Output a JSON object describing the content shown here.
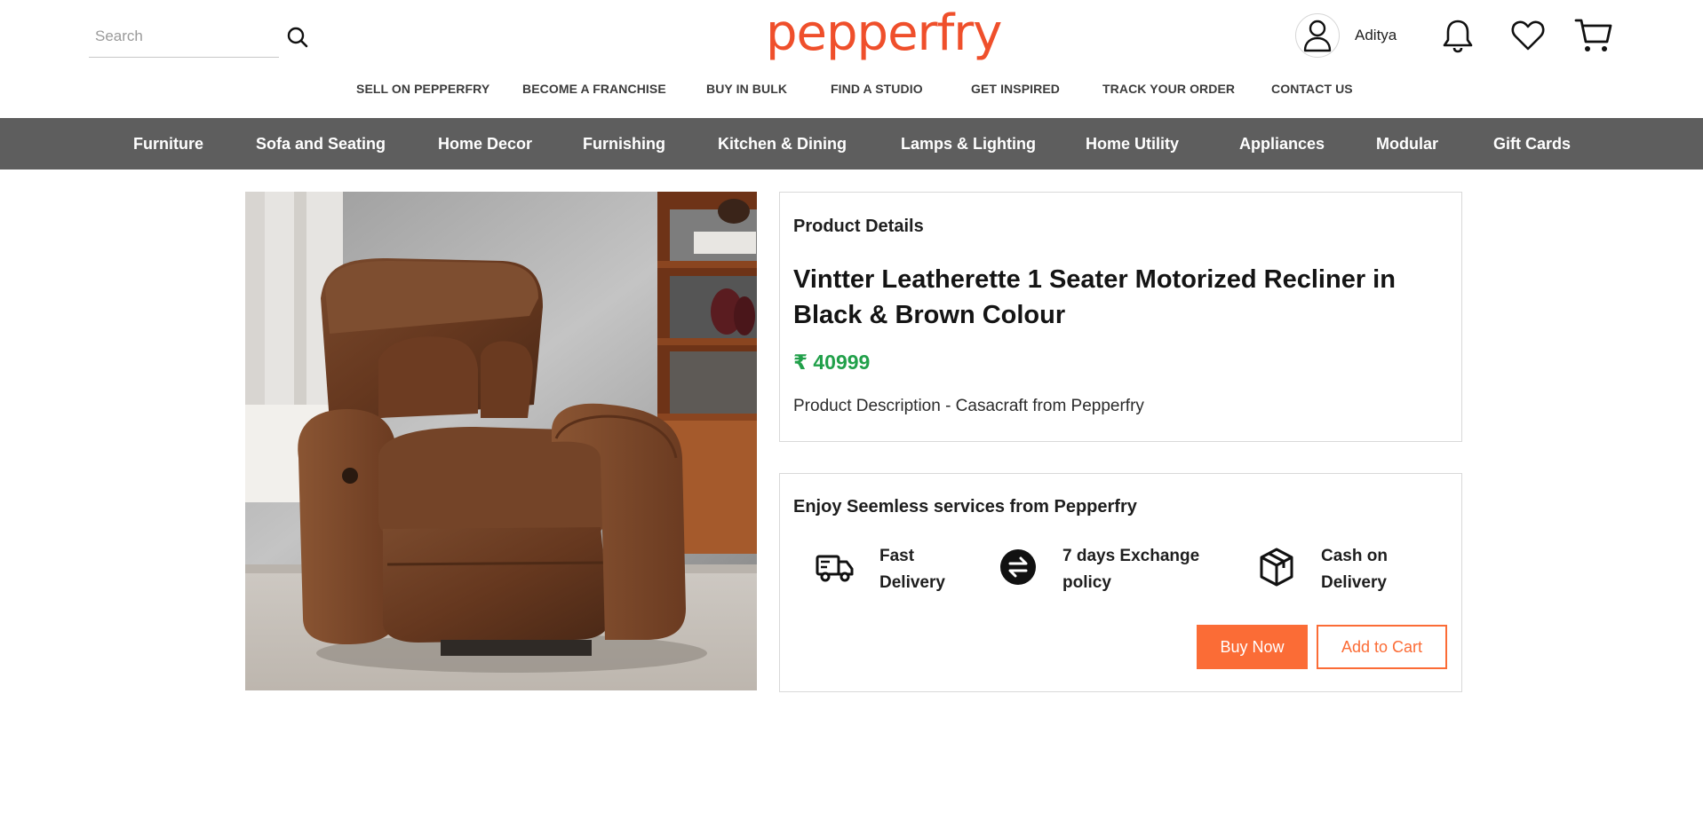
{
  "header": {
    "search_placeholder": "Search",
    "logo_text": "pepperfry",
    "user_name": "Aditya"
  },
  "top_links": [
    {
      "label": "SELL ON PEPPERFRY"
    },
    {
      "label": "BECOME A FRANCHISE"
    },
    {
      "label": "BUY IN BULK"
    },
    {
      "label": "FIND A STUDIO"
    },
    {
      "label": "GET INSPIRED"
    },
    {
      "label": "TRACK YOUR ORDER"
    },
    {
      "label": "CONTACT US"
    }
  ],
  "categories": [
    {
      "label": "Furniture"
    },
    {
      "label": "Sofa and Seating"
    },
    {
      "label": "Home Decor"
    },
    {
      "label": "Furnishing"
    },
    {
      "label": "Kitchen & Dining"
    },
    {
      "label": "Lamps & Lighting"
    },
    {
      "label": "Home Utility"
    },
    {
      "label": "Appliances"
    },
    {
      "label": "Modular"
    },
    {
      "label": "Gift Cards"
    }
  ],
  "product": {
    "section_heading": "Product Details",
    "title": "Vintter Leatherette 1 Seater Motorized Recliner in Black & Brown Colour",
    "price": "₹ 40999",
    "description": "Product Description - Casacraft from Pepperfry"
  },
  "services": {
    "heading": "Enjoy Seemless services from Pepperfry",
    "items": [
      {
        "line1": "Fast",
        "line2": "Delivery",
        "icon": "delivery-truck-icon"
      },
      {
        "line1": "7 days Exchange",
        "line2": "policy",
        "icon": "exchange-icon"
      },
      {
        "line1": "Cash on",
        "line2": "Delivery",
        "icon": "cube-box-icon"
      }
    ],
    "buy_now_label": "Buy Now",
    "add_to_cart_label": "Add to Cart"
  },
  "colors": {
    "brand": "#ef4f2b",
    "price": "#21a04a",
    "button_orange": "#fb6c36",
    "category_bar": "#5e5e5e"
  }
}
